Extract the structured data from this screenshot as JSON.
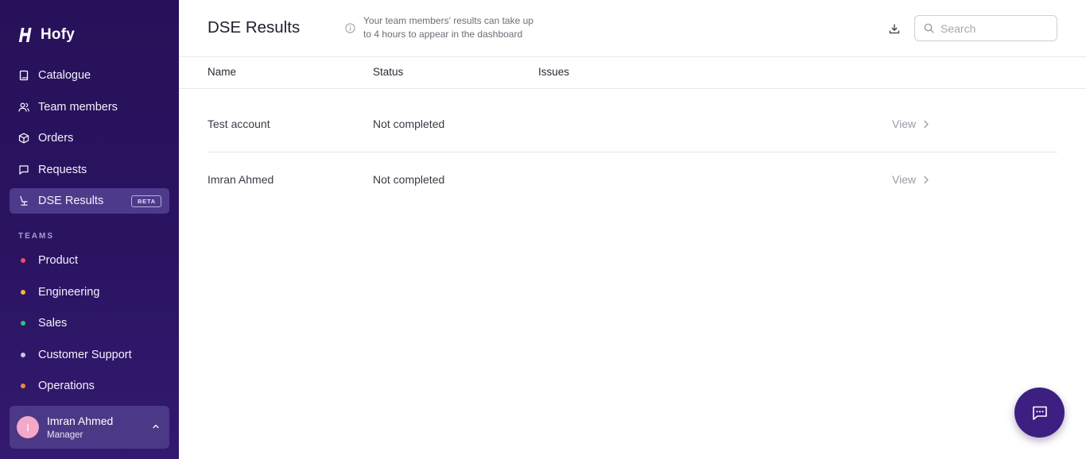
{
  "brand": {
    "name": "Hofy"
  },
  "sidebar": {
    "nav": [
      {
        "label": "Catalogue",
        "icon": "book-icon"
      },
      {
        "label": "Team members",
        "icon": "users-icon"
      },
      {
        "label": "Orders",
        "icon": "box-icon"
      },
      {
        "label": "Requests",
        "icon": "message-icon"
      },
      {
        "label": "DSE Results",
        "icon": "desk-chair-icon",
        "badge": "BETA",
        "active": true
      }
    ],
    "teams_heading": "TEAMS",
    "teams": [
      {
        "label": "Product",
        "color": "#f0496a"
      },
      {
        "label": "Engineering",
        "color": "#f6b73c"
      },
      {
        "label": "Sales",
        "color": "#2ec27e"
      },
      {
        "label": "Customer Support",
        "color": "#c9c4e4"
      },
      {
        "label": "Operations",
        "color": "#f08a3c"
      }
    ],
    "user": {
      "initial": "I",
      "name": "Imran Ahmed",
      "role": "Manager"
    }
  },
  "header": {
    "title": "DSE Results",
    "notice_line1": "Your team members' results can take up",
    "notice_line2": "to 4 hours to appear in the dashboard",
    "search_placeholder": "Search"
  },
  "table": {
    "columns": [
      "Name",
      "Status",
      "Issues"
    ],
    "rows": [
      {
        "name": "Test account",
        "status": "Not completed",
        "issues": "",
        "action": "View"
      },
      {
        "name": "Imran Ahmed",
        "status": "Not completed",
        "issues": "",
        "action": "View"
      }
    ]
  },
  "colors": {
    "sidebar_bg": "#271159",
    "active_item_bg": "#4e3a8a",
    "accent": "#3c1f80"
  }
}
